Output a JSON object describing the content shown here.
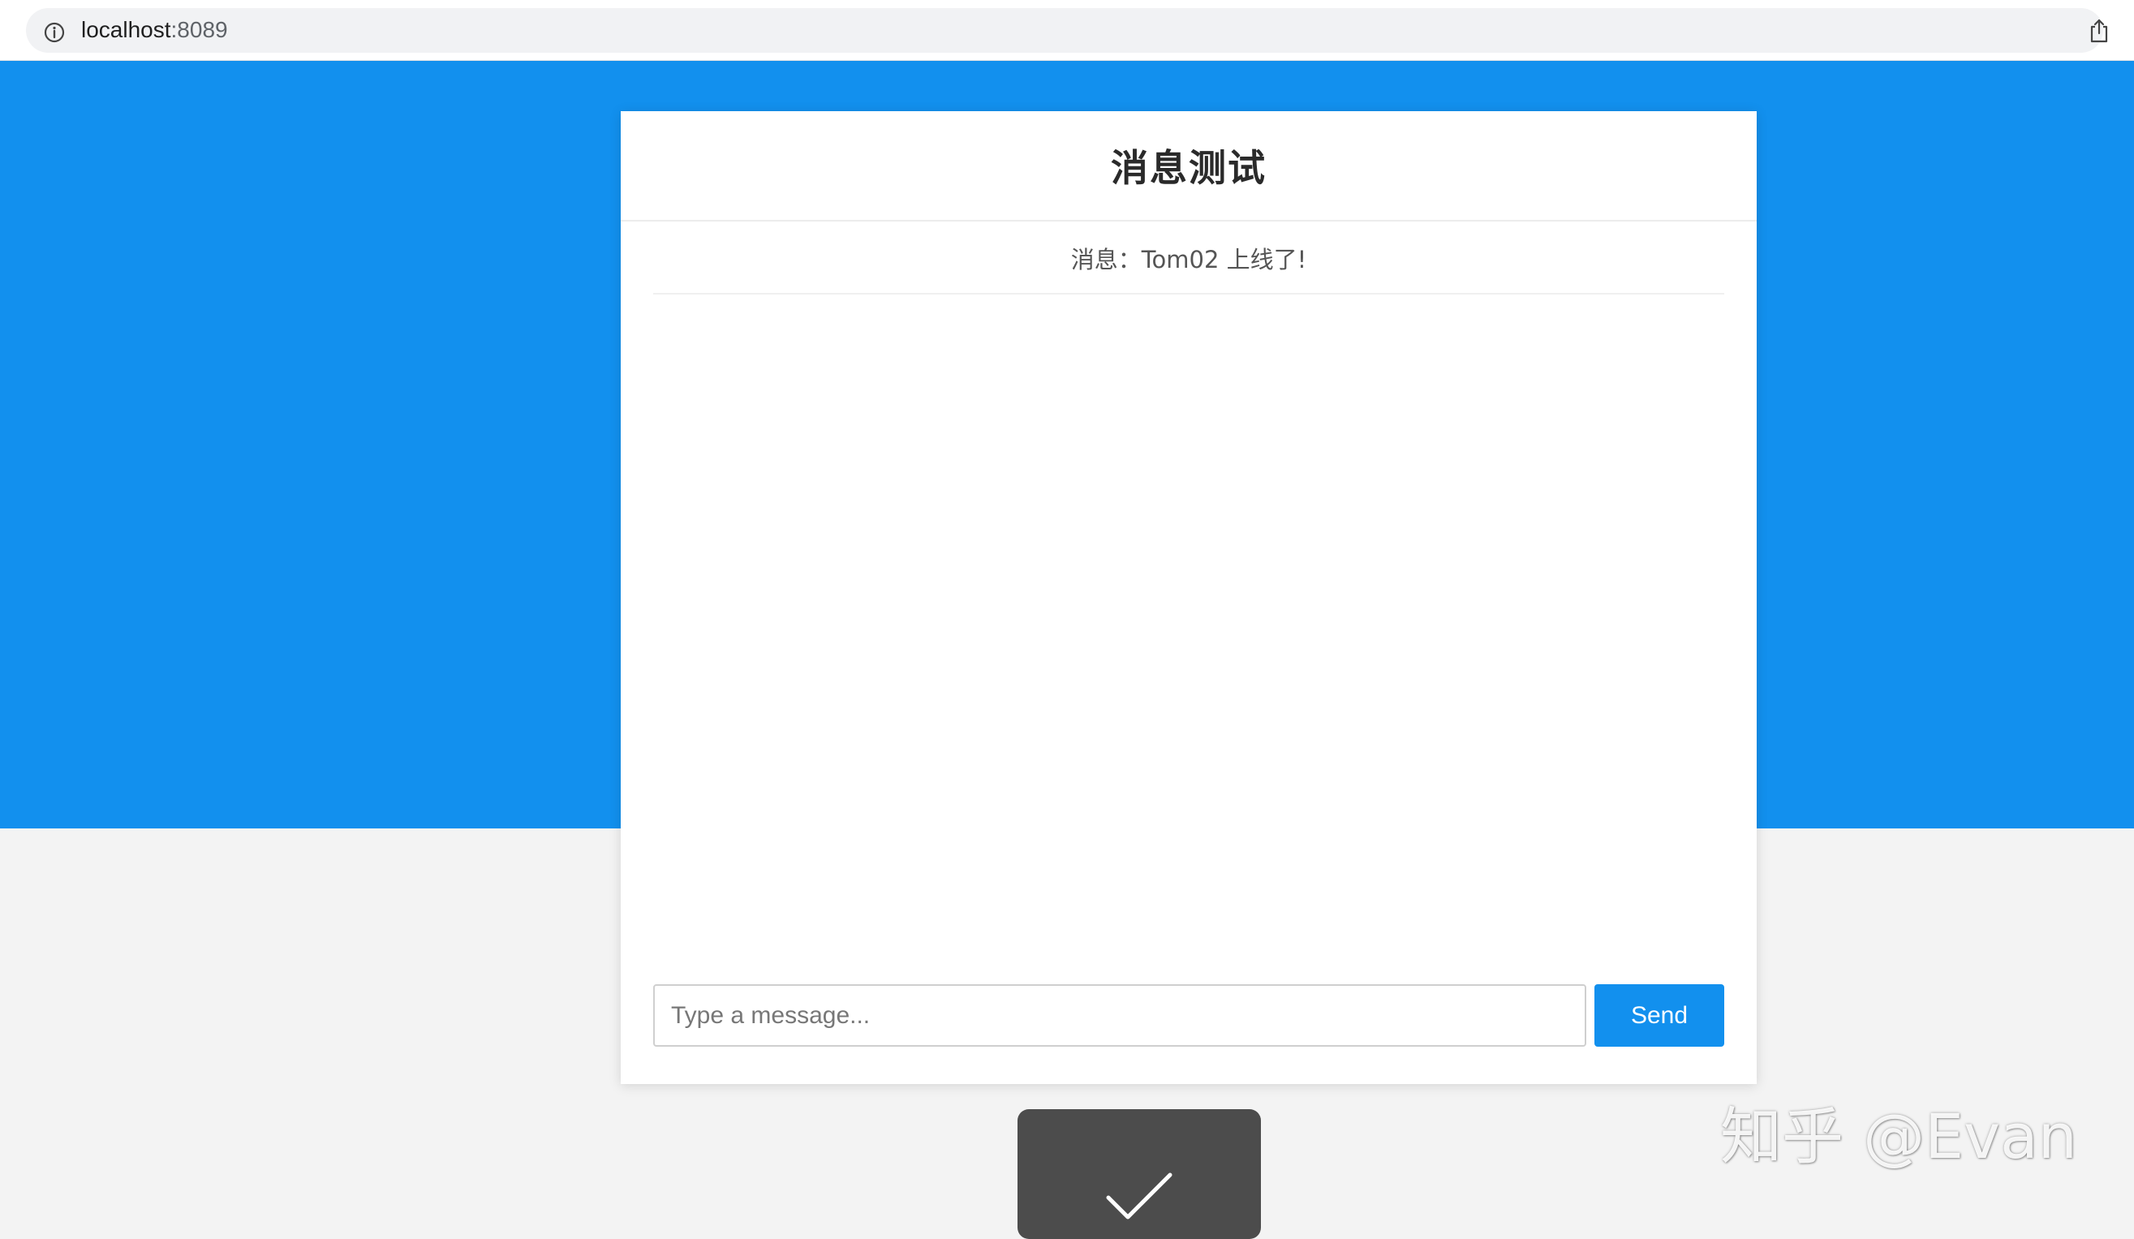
{
  "browser": {
    "url_host": "localhost",
    "url_port": ":8089",
    "info_icon": "info-icon",
    "share_icon": "share-icon"
  },
  "chat": {
    "title": "消息测试",
    "messages": [
      {
        "text": "消息：Tom02 上线了!"
      }
    ],
    "input": {
      "value": "",
      "placeholder": "Type a message..."
    },
    "send_label": "Send"
  },
  "toast": {
    "icon": "checkmark-icon"
  },
  "watermark": {
    "text": "知乎 @Evan"
  },
  "colors": {
    "accent": "#1290ee",
    "page_bg": "#f3f3f3",
    "toast_bg": "#4c4c4c"
  }
}
